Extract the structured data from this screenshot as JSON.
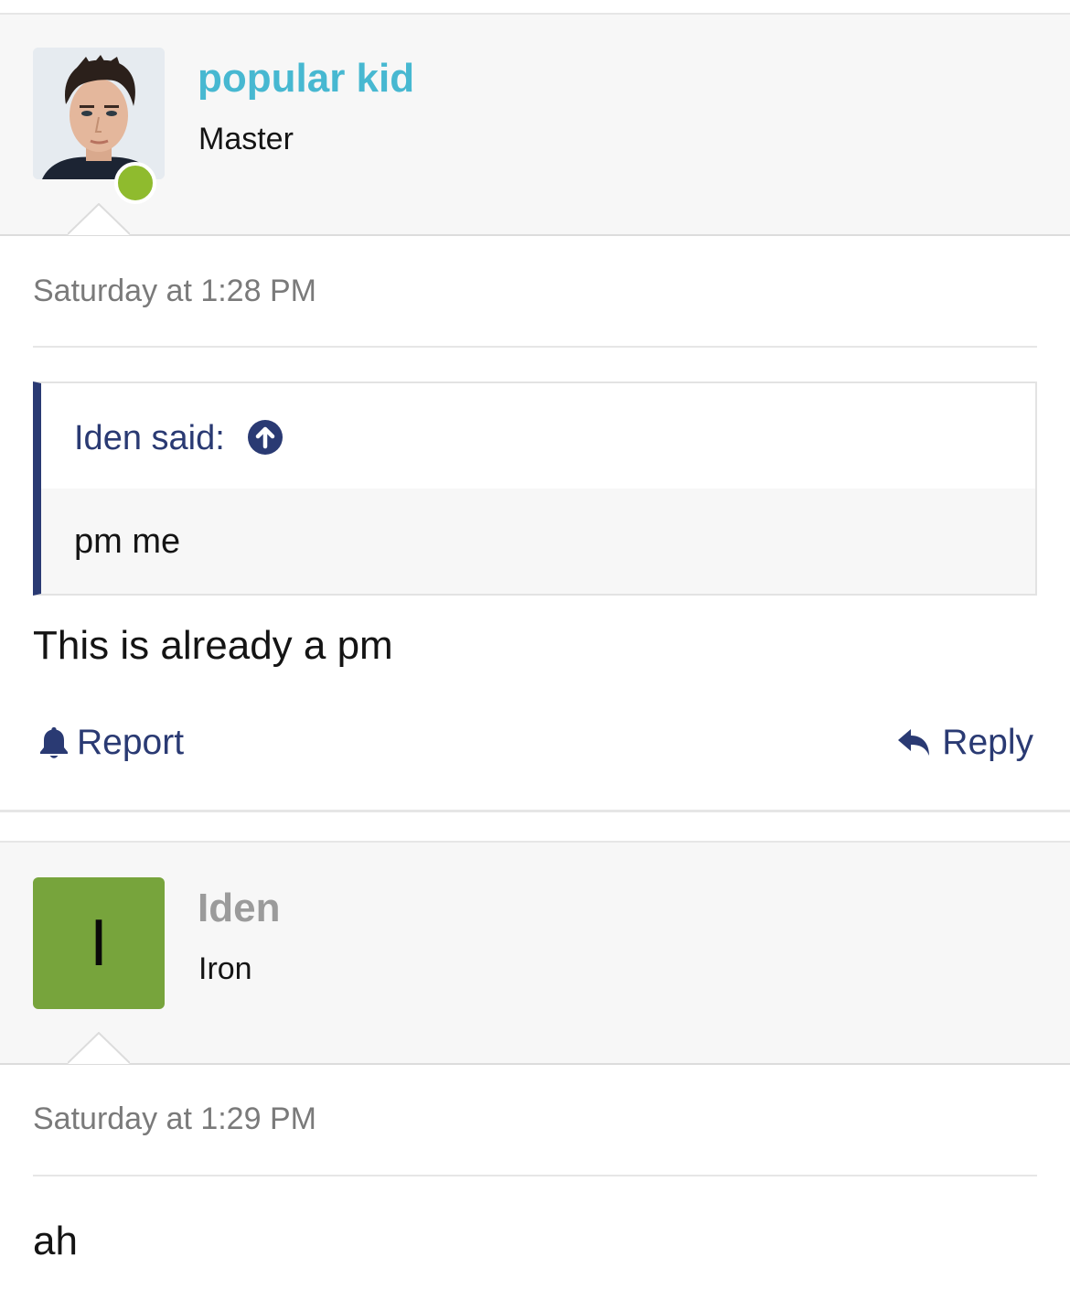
{
  "posts": [
    {
      "author": {
        "name": "popular kid",
        "title": "Master",
        "online": true,
        "name_color": "#47b8d1"
      },
      "timestamp": "Saturday at 1:28 PM",
      "quote": {
        "author_label": "Iden said:",
        "jump_icon": "arrow-up-circle-icon",
        "text": "pm me"
      },
      "message": "This is already a pm",
      "actions": {
        "report_label": "Report",
        "report_icon": "bell-icon",
        "reply_label": "Reply",
        "reply_icon": "reply-arrow-icon"
      }
    },
    {
      "author": {
        "name": "Iden",
        "title": "Iron",
        "avatar_letter": "I",
        "avatar_color": "#77a43c",
        "name_color": "#9b9b9b"
      },
      "timestamp": "Saturday at 1:29 PM",
      "message": "ah"
    }
  ],
  "colors": {
    "accent": "#2a3a73",
    "online": "#8fbb2e",
    "header_bg": "#f7f7f7"
  }
}
